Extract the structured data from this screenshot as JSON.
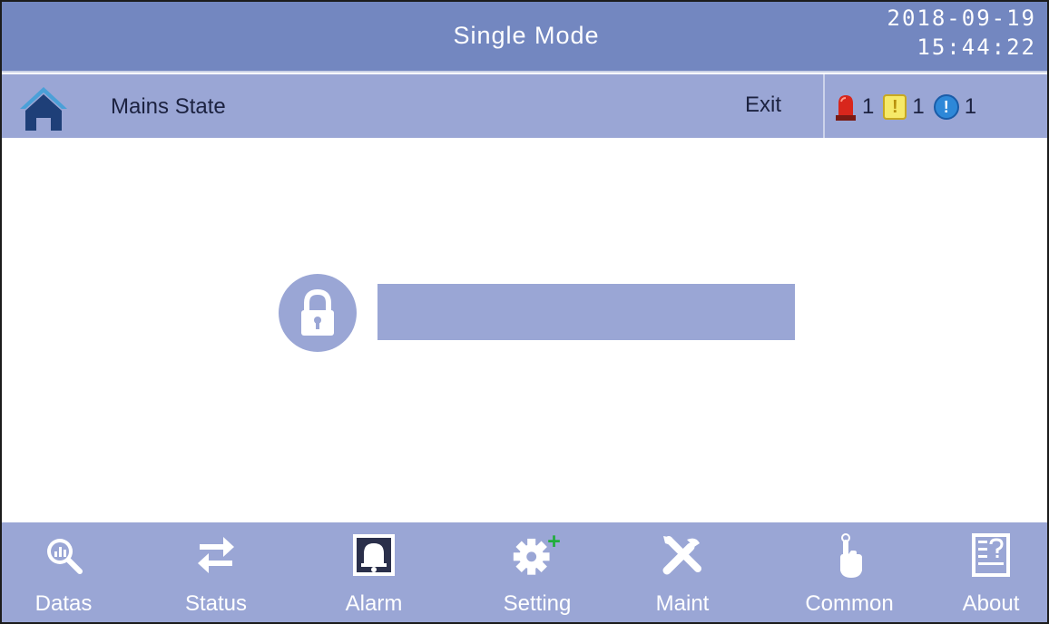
{
  "header": {
    "title": "Single Mode",
    "date": "2018-09-19",
    "time": "15:44:22"
  },
  "subheader": {
    "title": "Mains State",
    "exit_label": "Exit",
    "home_icon": "home-icon",
    "alarms": {
      "critical_count": "1",
      "warning_count": "1",
      "info_count": "1",
      "warning_glyph": "!",
      "info_glyph": "!"
    }
  },
  "login": {
    "lock_icon": "lock-icon",
    "password_value": ""
  },
  "nav": {
    "items": [
      {
        "label": "Datas",
        "icon": "datas-icon"
      },
      {
        "label": "Status",
        "icon": "status-icon"
      },
      {
        "label": "Alarm",
        "icon": "alarm-icon"
      },
      {
        "label": "Setting",
        "icon": "setting-icon"
      },
      {
        "label": "Maint",
        "icon": "maint-icon"
      },
      {
        "label": "Common",
        "icon": "common-icon"
      },
      {
        "label": "About",
        "icon": "about-icon"
      }
    ]
  },
  "colors": {
    "titlebar": "#7387c0",
    "bars": "#9aa6d5",
    "text_dark": "#1c2240",
    "text_light": "#ffffff"
  }
}
